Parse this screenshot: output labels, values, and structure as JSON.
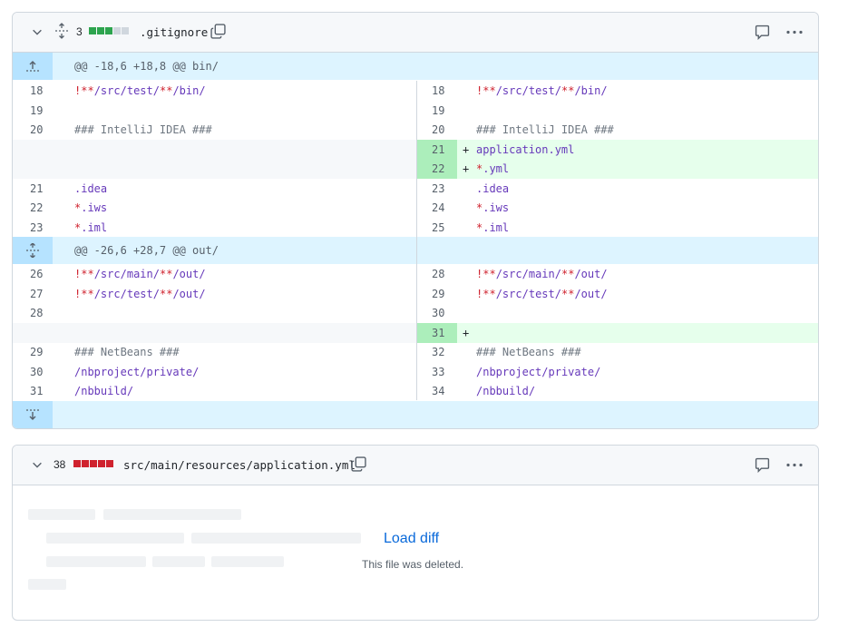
{
  "file1": {
    "change_count": "3",
    "blocks": [
      "#2da44e",
      "#2da44e",
      "#2da44e",
      "#d0d7de",
      "#d0d7de"
    ],
    "file_name": ".gitignore",
    "hunk1": "@@ -18,6 +18,8 @@ bin/",
    "hunk2": "@@ -26,6 +28,7 @@ out/",
    "rows": [
      {
        "ln": "18",
        "rn": "18",
        "t": "!**/src/test/**/bin/"
      },
      {
        "ln": "19",
        "rn": "19",
        "t": ""
      },
      {
        "ln": "20",
        "rn": "20",
        "t": "### IntelliJ IDEA ###"
      },
      {
        "ln": "",
        "rn": "21",
        "t": "application.yml",
        "mk": "+"
      },
      {
        "ln": "",
        "rn": "22",
        "t": "*.yml",
        "mk": "+"
      },
      {
        "ln": "21",
        "rn": "23",
        "t": ".idea"
      },
      {
        "ln": "22",
        "rn": "24",
        "t": "*.iws"
      },
      {
        "ln": "23",
        "rn": "25",
        "t": "*.iml"
      },
      {
        "ln": "26",
        "rn": "28",
        "t": "!**/src/main/**/out/"
      },
      {
        "ln": "27",
        "rn": "29",
        "t": "!**/src/test/**/out/"
      },
      {
        "ln": "28",
        "rn": "30",
        "t": ""
      },
      {
        "ln": "",
        "rn": "31",
        "t": "",
        "mk": "+"
      },
      {
        "ln": "29",
        "rn": "32",
        "t": "### NetBeans ###"
      },
      {
        "ln": "30",
        "rn": "33",
        "t": "/nbproject/private/"
      },
      {
        "ln": "31",
        "rn": "34",
        "t": "/nbbuild/"
      }
    ]
  },
  "file2": {
    "change_count": "38",
    "blocks": [
      "#cf222e",
      "#cf222e",
      "#cf222e",
      "#cf222e",
      "#cf222e"
    ],
    "file_name": "src/main/resources/application.yml",
    "load_diff": "Load diff",
    "deleted_text": "This file was deleted."
  },
  "colors": {
    "add": "#2da44e",
    "del": "#cf222e",
    "link": "#0969da"
  }
}
